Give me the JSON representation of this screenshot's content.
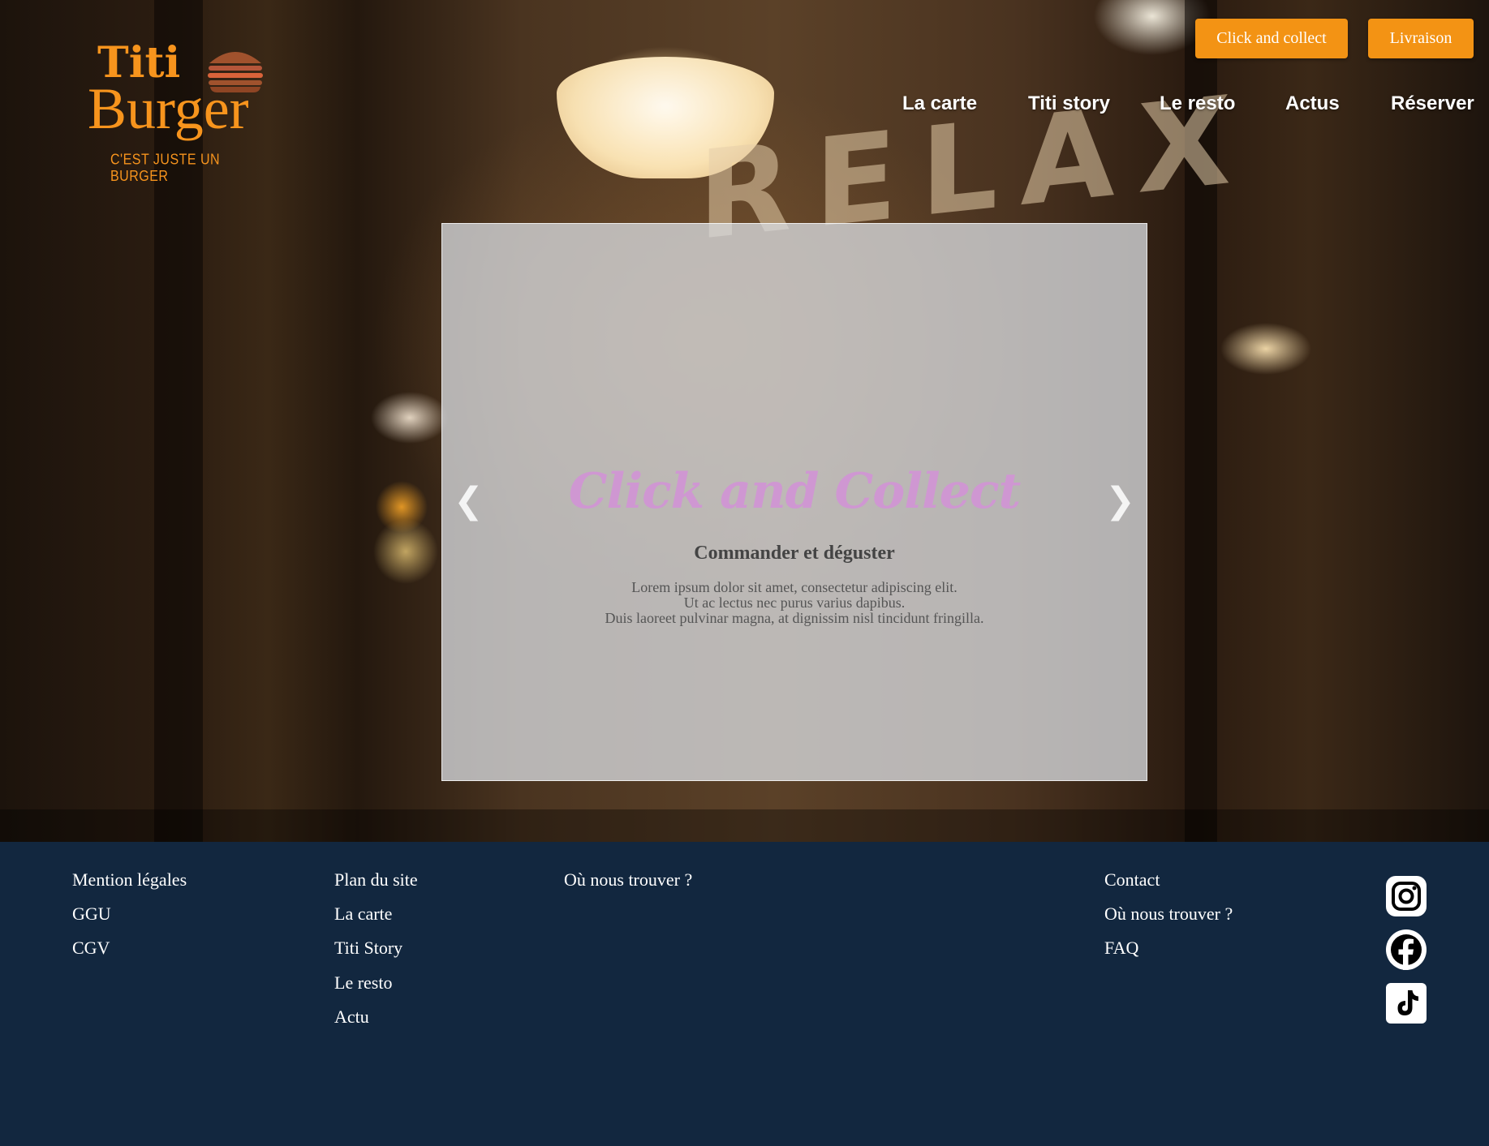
{
  "brand": {
    "logo_top": "Titi",
    "logo_bottom": "Burger",
    "tagline": "C'EST JUSTE UN BURGER",
    "accent_color": "#f39314",
    "footer_bg": "#12273f"
  },
  "top_buttons": {
    "click_collect": "Click and collect",
    "delivery": "Livraison"
  },
  "nav": {
    "items": [
      "La carte",
      "Titi story",
      "Le resto",
      "Actus",
      "Réserver"
    ]
  },
  "hero": {
    "background_sign": "RELAX"
  },
  "carousel": {
    "prev_icon": "❮",
    "next_icon": "❯",
    "title": "Click and Collect",
    "subtitle": "Commander et déguster",
    "body": [
      "Lorem ipsum dolor sit amet, consectetur adipiscing elit.",
      "Ut ac lectus nec purus varius dapibus.",
      "Duis laoreet pulvinar magna, at dignissim nisl tincidunt fringilla."
    ]
  },
  "footer": {
    "col1": [
      "Mention légales",
      "GGU",
      "CGV"
    ],
    "col2": [
      "Plan du site",
      "La carte",
      "Titi Story",
      "Le resto",
      "Actu"
    ],
    "col3": [
      "Où nous trouver ?"
    ],
    "col4": [
      "Contact",
      "Où nous trouver ?",
      "FAQ"
    ],
    "social_icons": [
      "instagram-icon",
      "facebook-icon",
      "tiktok-icon"
    ]
  }
}
